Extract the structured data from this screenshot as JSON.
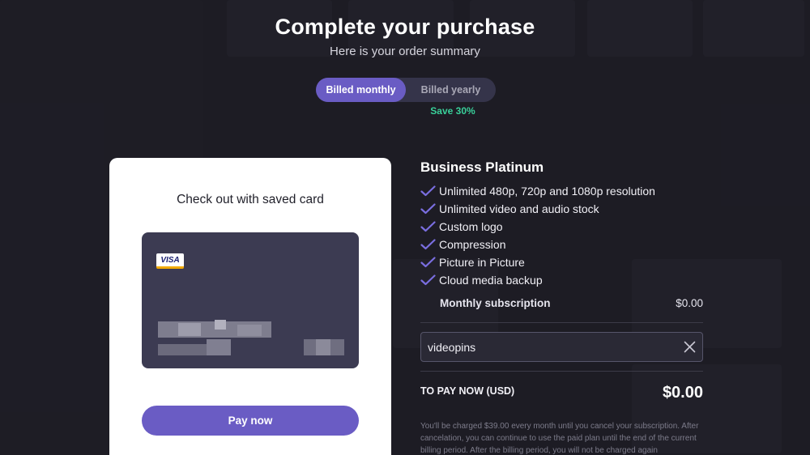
{
  "header": {
    "title": "Complete your purchase",
    "subtitle": "Here is your order summary"
  },
  "billing": {
    "monthly_label": "Billed monthly",
    "yearly_label": "Billed yearly",
    "selected": "monthly",
    "save_badge": "Save 30%"
  },
  "checkout": {
    "heading": "Check out with saved card",
    "card_brand": "VISA",
    "pay_button": "Pay now"
  },
  "plan": {
    "name": "Business Platinum",
    "features": [
      "Unlimited 480p, 720p and 1080p resolution",
      "Unlimited video and audio stock",
      "Custom logo",
      "Compression",
      "Picture in Picture",
      "Cloud media backup"
    ],
    "subscription_label": "Monthly subscription",
    "subscription_price": "$0.00"
  },
  "coupon": {
    "value": "videopins"
  },
  "total": {
    "label": "TO PAY NOW (USD)",
    "amount": "$0.00"
  },
  "disclaimer": "You'll be charged $39.00 every month until you cancel your subscription. After cancelation, you can continue to use the paid plan until the end of the current billing period. After the billing period, you will not be charged again",
  "colors": {
    "accent": "#6a5cc4",
    "save_green": "#39d09a",
    "background": "#24232c"
  }
}
